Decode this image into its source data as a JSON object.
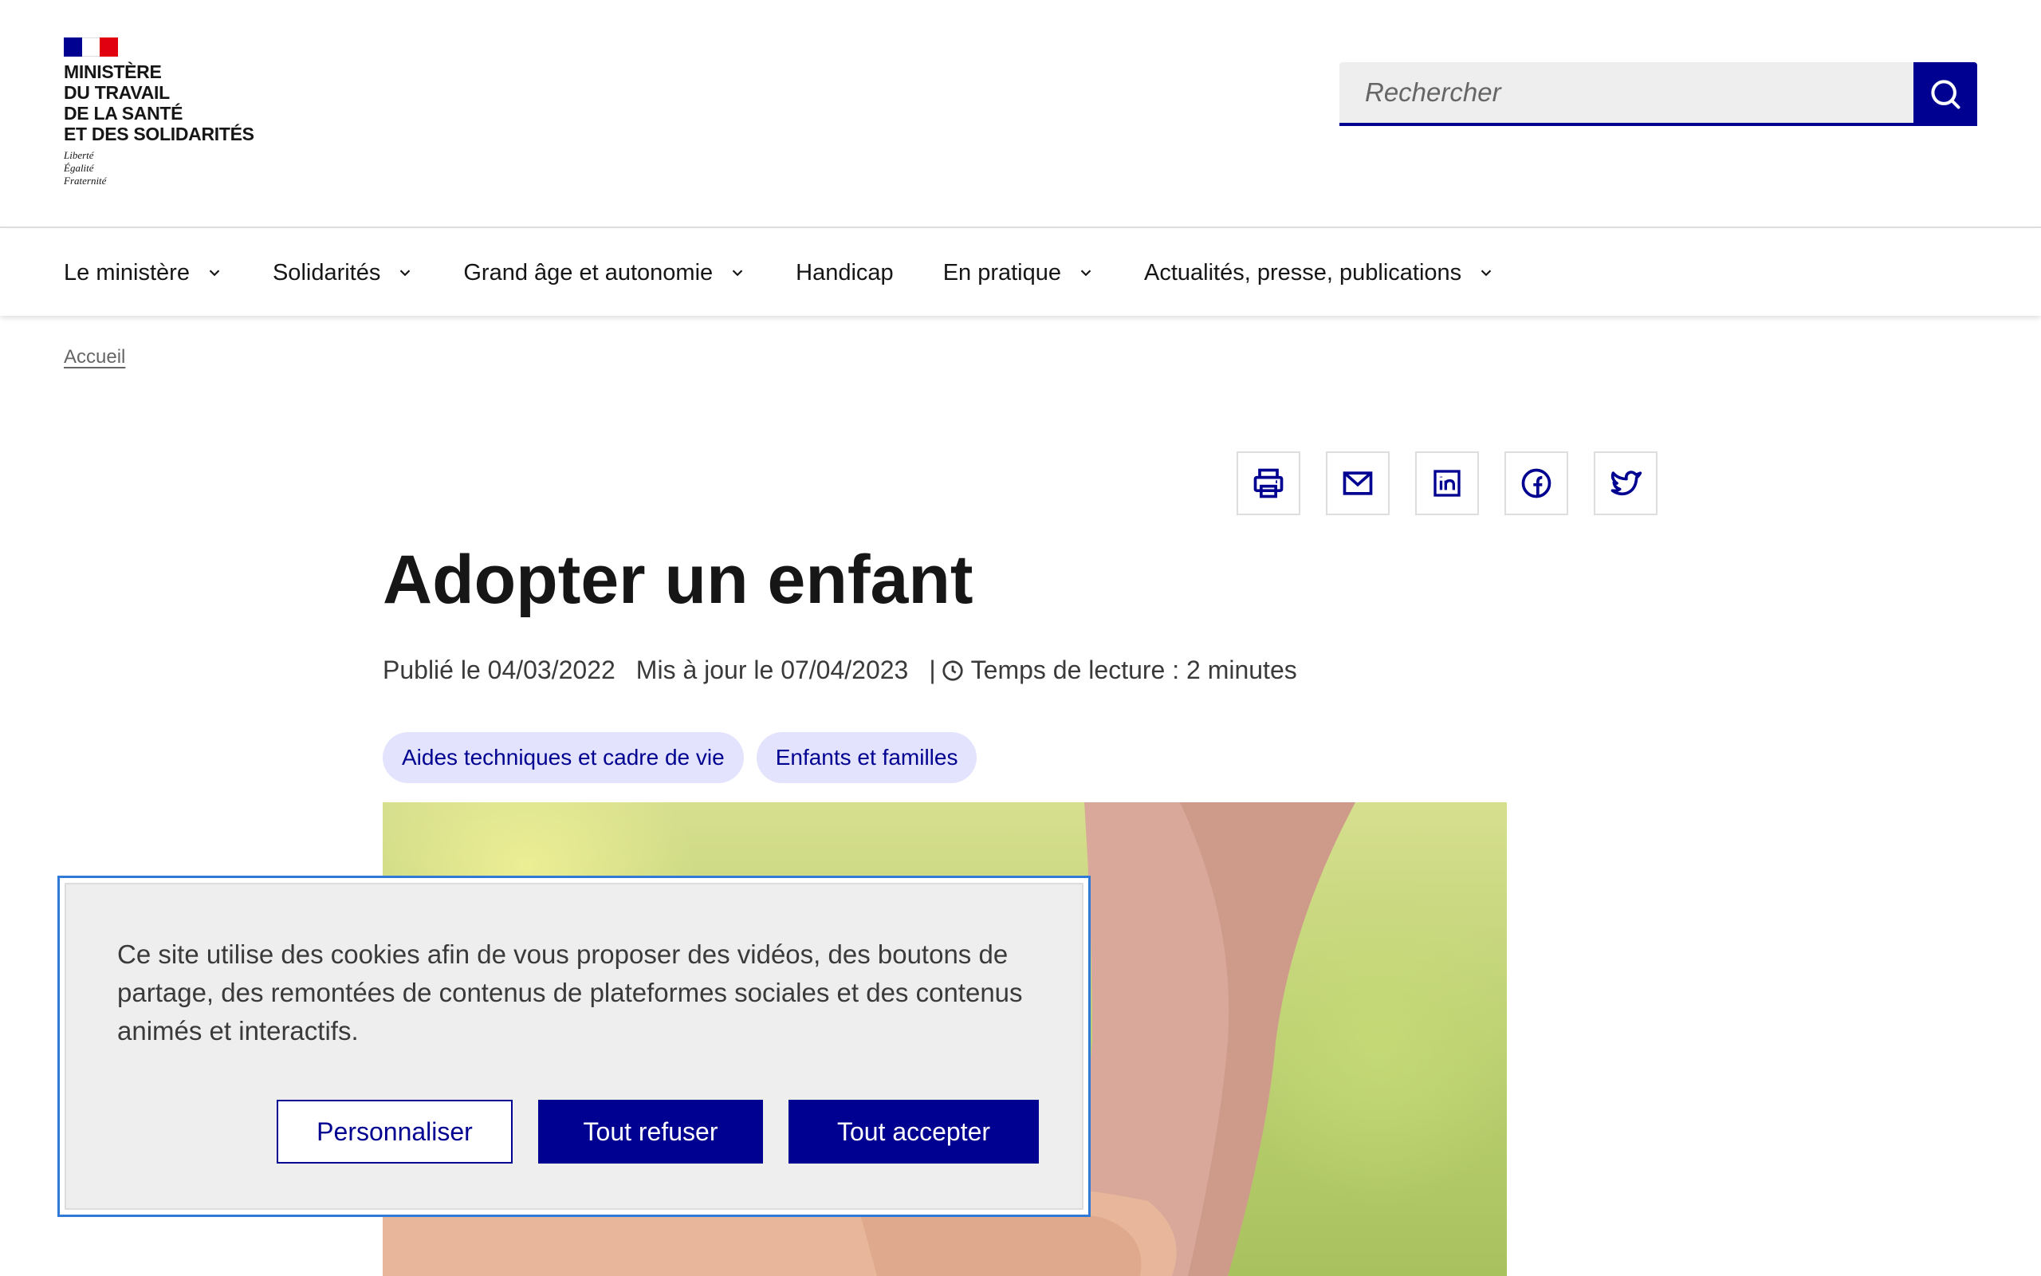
{
  "header": {
    "logo": {
      "title": "MINISTÈRE\nDU TRAVAIL\nDE LA SANTÉ\nET DES SOLIDARITÉS",
      "motto": "Liberté\nÉgalité\nFraternité"
    },
    "search": {
      "placeholder": "Rechercher",
      "icon": "search-icon"
    }
  },
  "nav": {
    "items": [
      {
        "label": "Le ministère",
        "has_dropdown": true
      },
      {
        "label": "Solidarités",
        "has_dropdown": true
      },
      {
        "label": "Grand âge et autonomie",
        "has_dropdown": true
      },
      {
        "label": "Handicap",
        "has_dropdown": false
      },
      {
        "label": "En pratique",
        "has_dropdown": true
      },
      {
        "label": "Actualités, presse, publications",
        "has_dropdown": true
      }
    ]
  },
  "breadcrumb": {
    "items": [
      "Accueil"
    ]
  },
  "share": {
    "icons": [
      "print-icon",
      "mail-icon",
      "linkedin-icon",
      "facebook-icon",
      "twitter-icon"
    ]
  },
  "article": {
    "title": "Adopter un enfant",
    "published": "Publié le 04/03/2022",
    "updated": "Mis à jour le 07/04/2023",
    "separator": "|",
    "reading_time": "Temps de lecture : 2 minutes",
    "tags": [
      "Aides techniques et cadre de vie",
      "Enfants et familles"
    ]
  },
  "cookie_banner": {
    "text": "Ce site utilise des cookies afin de vous proposer des vidéos, des boutons de partage, des remontées de contenus de plateformes sociales et des contenus animés et interactifs.",
    "customize_label": "Personnaliser",
    "refuse_label": "Tout refuser",
    "accept_label": "Tout accepter"
  },
  "colors": {
    "primary": "#000091",
    "tag_background": "#e3e3fd",
    "banner_background": "#eeeeee",
    "focus_outline": "#2f7ad6",
    "flag_red": "#e1000f"
  }
}
